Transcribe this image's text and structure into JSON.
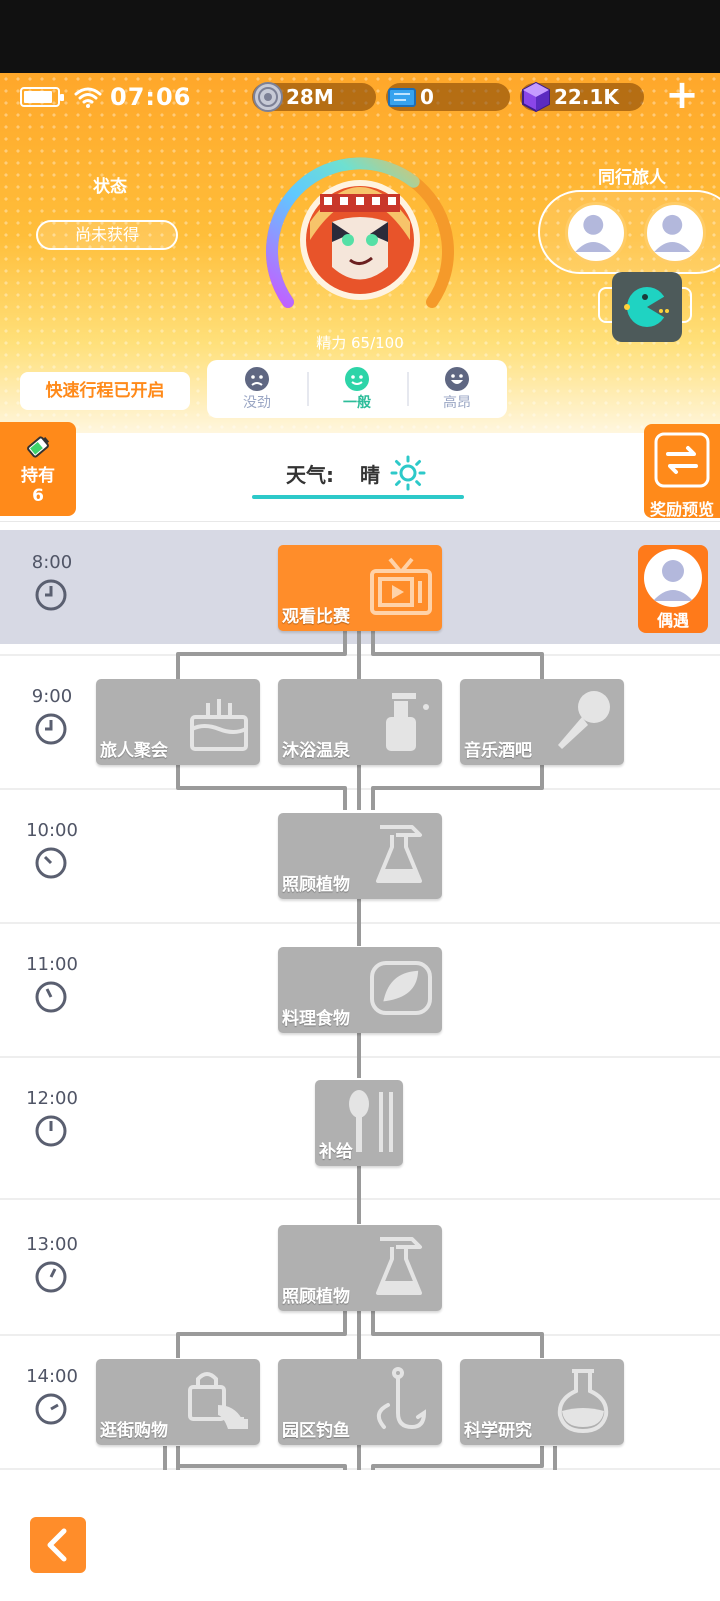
{
  "status_bar": {
    "time": "07:06"
  },
  "currencies": [
    {
      "name": "coin",
      "value": "28M"
    },
    {
      "name": "ticket",
      "value": "0"
    },
    {
      "name": "crystal",
      "value": "22.1K"
    }
  ],
  "header": {
    "state_label": "状态",
    "state_value": "尚未获得",
    "companions_label": "同行旅人",
    "energy_text": "精力 65/100",
    "energy_level": 0.65
  },
  "fast_trip_label": "快速行程已开启",
  "moods": [
    {
      "label": "没劲",
      "active": false
    },
    {
      "label": "一般",
      "active": true
    },
    {
      "label": "高昂",
      "active": false
    }
  ],
  "hold": {
    "label": "持有",
    "count": "6"
  },
  "reward_preview_label": "奖励预览",
  "weather": {
    "label": "天气:",
    "value": "晴",
    "icon": "sun-icon"
  },
  "schedule": {
    "times": [
      "8:00",
      "9:00",
      "10:00",
      "11:00",
      "12:00",
      "13:00",
      "14:00"
    ],
    "activities": {
      "watch_match": {
        "label": "观看比赛",
        "icon": "tv-icon"
      },
      "traveler_party": {
        "label": "旅人聚会",
        "icon": "cake-icon"
      },
      "hot_spring": {
        "label": "沐浴温泉",
        "icon": "soap-bottle-icon"
      },
      "music_bar": {
        "label": "音乐酒吧",
        "icon": "microphone-icon"
      },
      "plants_1": {
        "label": "照顾植物",
        "icon": "spray-bottle-icon"
      },
      "cook": {
        "label": "料理食物",
        "icon": "sushi-icon"
      },
      "supply": {
        "label": "补给",
        "icon": "spoon-icon"
      },
      "plants_2": {
        "label": "照顾植物",
        "icon": "spray-bottle-icon"
      },
      "shopping": {
        "label": "逛街购物",
        "icon": "shopping-bag-icon"
      },
      "fishing": {
        "label": "园区钓鱼",
        "icon": "fish-hook-icon"
      },
      "research": {
        "label": "科学研究",
        "icon": "flask-icon"
      }
    }
  },
  "encounter_label": "偶遇",
  "colors": {
    "accent": "#ff8d2a",
    "teal": "#2dc9c9",
    "inactive_tile": "#b0b0b0"
  }
}
